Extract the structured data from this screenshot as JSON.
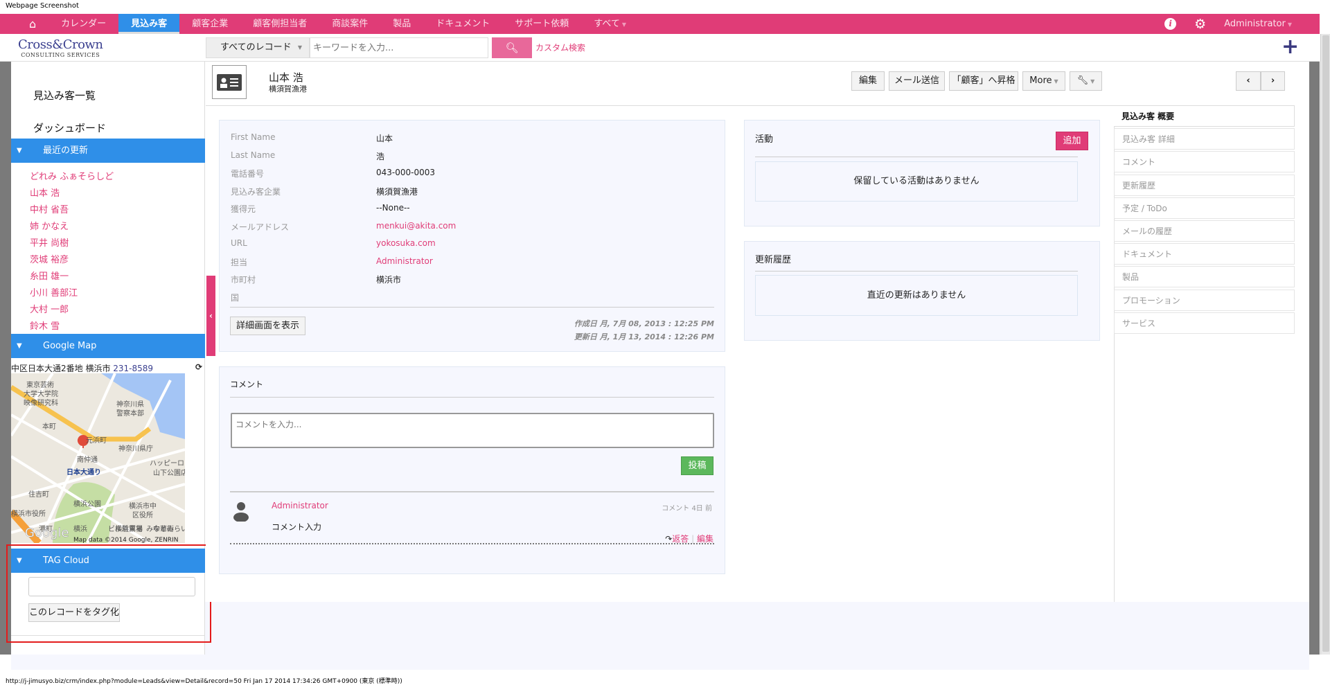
{
  "caption": "Webpage Screenshot",
  "colors": {
    "brand": "#e03c77",
    "accent_blue": "#2f8fe8",
    "success": "#5cb85c"
  },
  "nav": {
    "home_icon": "home-icon",
    "items": [
      "カレンダー",
      "見込み客",
      "顧客企業",
      "顧客側担当者",
      "商談案件",
      "製品",
      "ドキュメント",
      "サポート依頼",
      "すべて"
    ],
    "active": "見込み客",
    "user": "Administrator"
  },
  "logo": {
    "line1": "Cross&Crown",
    "line2": "CONSULTING SERVICES"
  },
  "search": {
    "scope": "すべてのレコード",
    "placeholder": "キーワードを入力...",
    "custom": "カスタム検索"
  },
  "sidebar": {
    "links": [
      "見込み客一覧",
      "ダッシュボード"
    ],
    "recent": {
      "title": "最近の更新",
      "items": [
        "どれみ ふぁそらしど",
        "山本 浩",
        "中村 省吾",
        "姉 かなえ",
        "平井 尚樹",
        "茨城 裕彦",
        "糸田 雄一",
        "小川 善部江",
        "大村 一郎",
        "鈴木 雪"
      ]
    },
    "map": {
      "title": "Google Map",
      "address": "中区日本大通2番地 横浜市",
      "zip": "231-8589",
      "labels": [
        "東京芸術",
        "大学大学院",
        "映像研究科",
        "神奈川県",
        "警察本部",
        "本町",
        "元浜町",
        "神奈川県庁",
        "南仲通",
        "日本大通り",
        "ハッピーローン",
        "山下公園店",
        "住吉町",
        "横浜公園",
        "横浜市中",
        "区役所",
        "みなとみらい線",
        "横浜市役所",
        "港町",
        "横浜貿易",
        "ビル駐車場",
        "中華街",
        "横浜"
      ],
      "google": "Google",
      "credit": "Map data ©2014 Google, ZENRIN"
    },
    "tag": {
      "title": "TAG Cloud",
      "input": "",
      "button": "このレコードをタグ化"
    }
  },
  "record": {
    "name": "山本 浩",
    "company": "横須賀漁港",
    "buttons": {
      "edit": "編集",
      "mail": "メール送信",
      "convert": "「顧客」へ昇格",
      "more": "More"
    }
  },
  "details": {
    "rows": [
      {
        "label": "First Name",
        "value": "山本"
      },
      {
        "label": "Last Name",
        "value": "浩"
      },
      {
        "label": "電話番号",
        "value": "043-000-0003"
      },
      {
        "label": "見込み客企業",
        "value": "横須賀漁港"
      },
      {
        "label": "獲得元",
        "value": "--None--"
      },
      {
        "label": "メールアドレス",
        "value": "menkui@akita.com",
        "link": true
      },
      {
        "label": "URL",
        "value": "yokosuka.com",
        "link": true
      },
      {
        "label": "担当",
        "value": "Administrator",
        "link": true
      },
      {
        "label": "市町村",
        "value": "横浜市"
      },
      {
        "label": "国",
        "value": ""
      }
    ],
    "show_full": "詳細画面を表示",
    "created": "作成日 月, 7月 08, 2013 : 12:25 PM",
    "modified": "更新日 月, 1月 13, 2014 : 12:26 PM"
  },
  "comments": {
    "title": "コメント",
    "placeholder": "コメントを入力...",
    "post": "投稿",
    "items": [
      {
        "author": "Administrator",
        "time": "コメント 4日 前",
        "text": "コメント入力",
        "reply": "返答",
        "edit": "編集"
      }
    ]
  },
  "activity": {
    "title": "活動",
    "add": "追加",
    "empty": "保留している活動はありません"
  },
  "updates": {
    "title": "更新履歴",
    "empty": "直近の更新はありません"
  },
  "right_tabs": [
    "見込み客 概要",
    "見込み客 詳細",
    "コメント",
    "更新履歴",
    "予定 / ToDo",
    "メールの履歴",
    "ドキュメント",
    "製品",
    "プロモーション",
    "サービス"
  ],
  "status_url": "http://j-jimusyo.biz/crm/index.php?module=Leads&view=Detail&record=50 Fri Jan 17 2014 17:34:26 GMT+0900 (東京 (標準時))"
}
